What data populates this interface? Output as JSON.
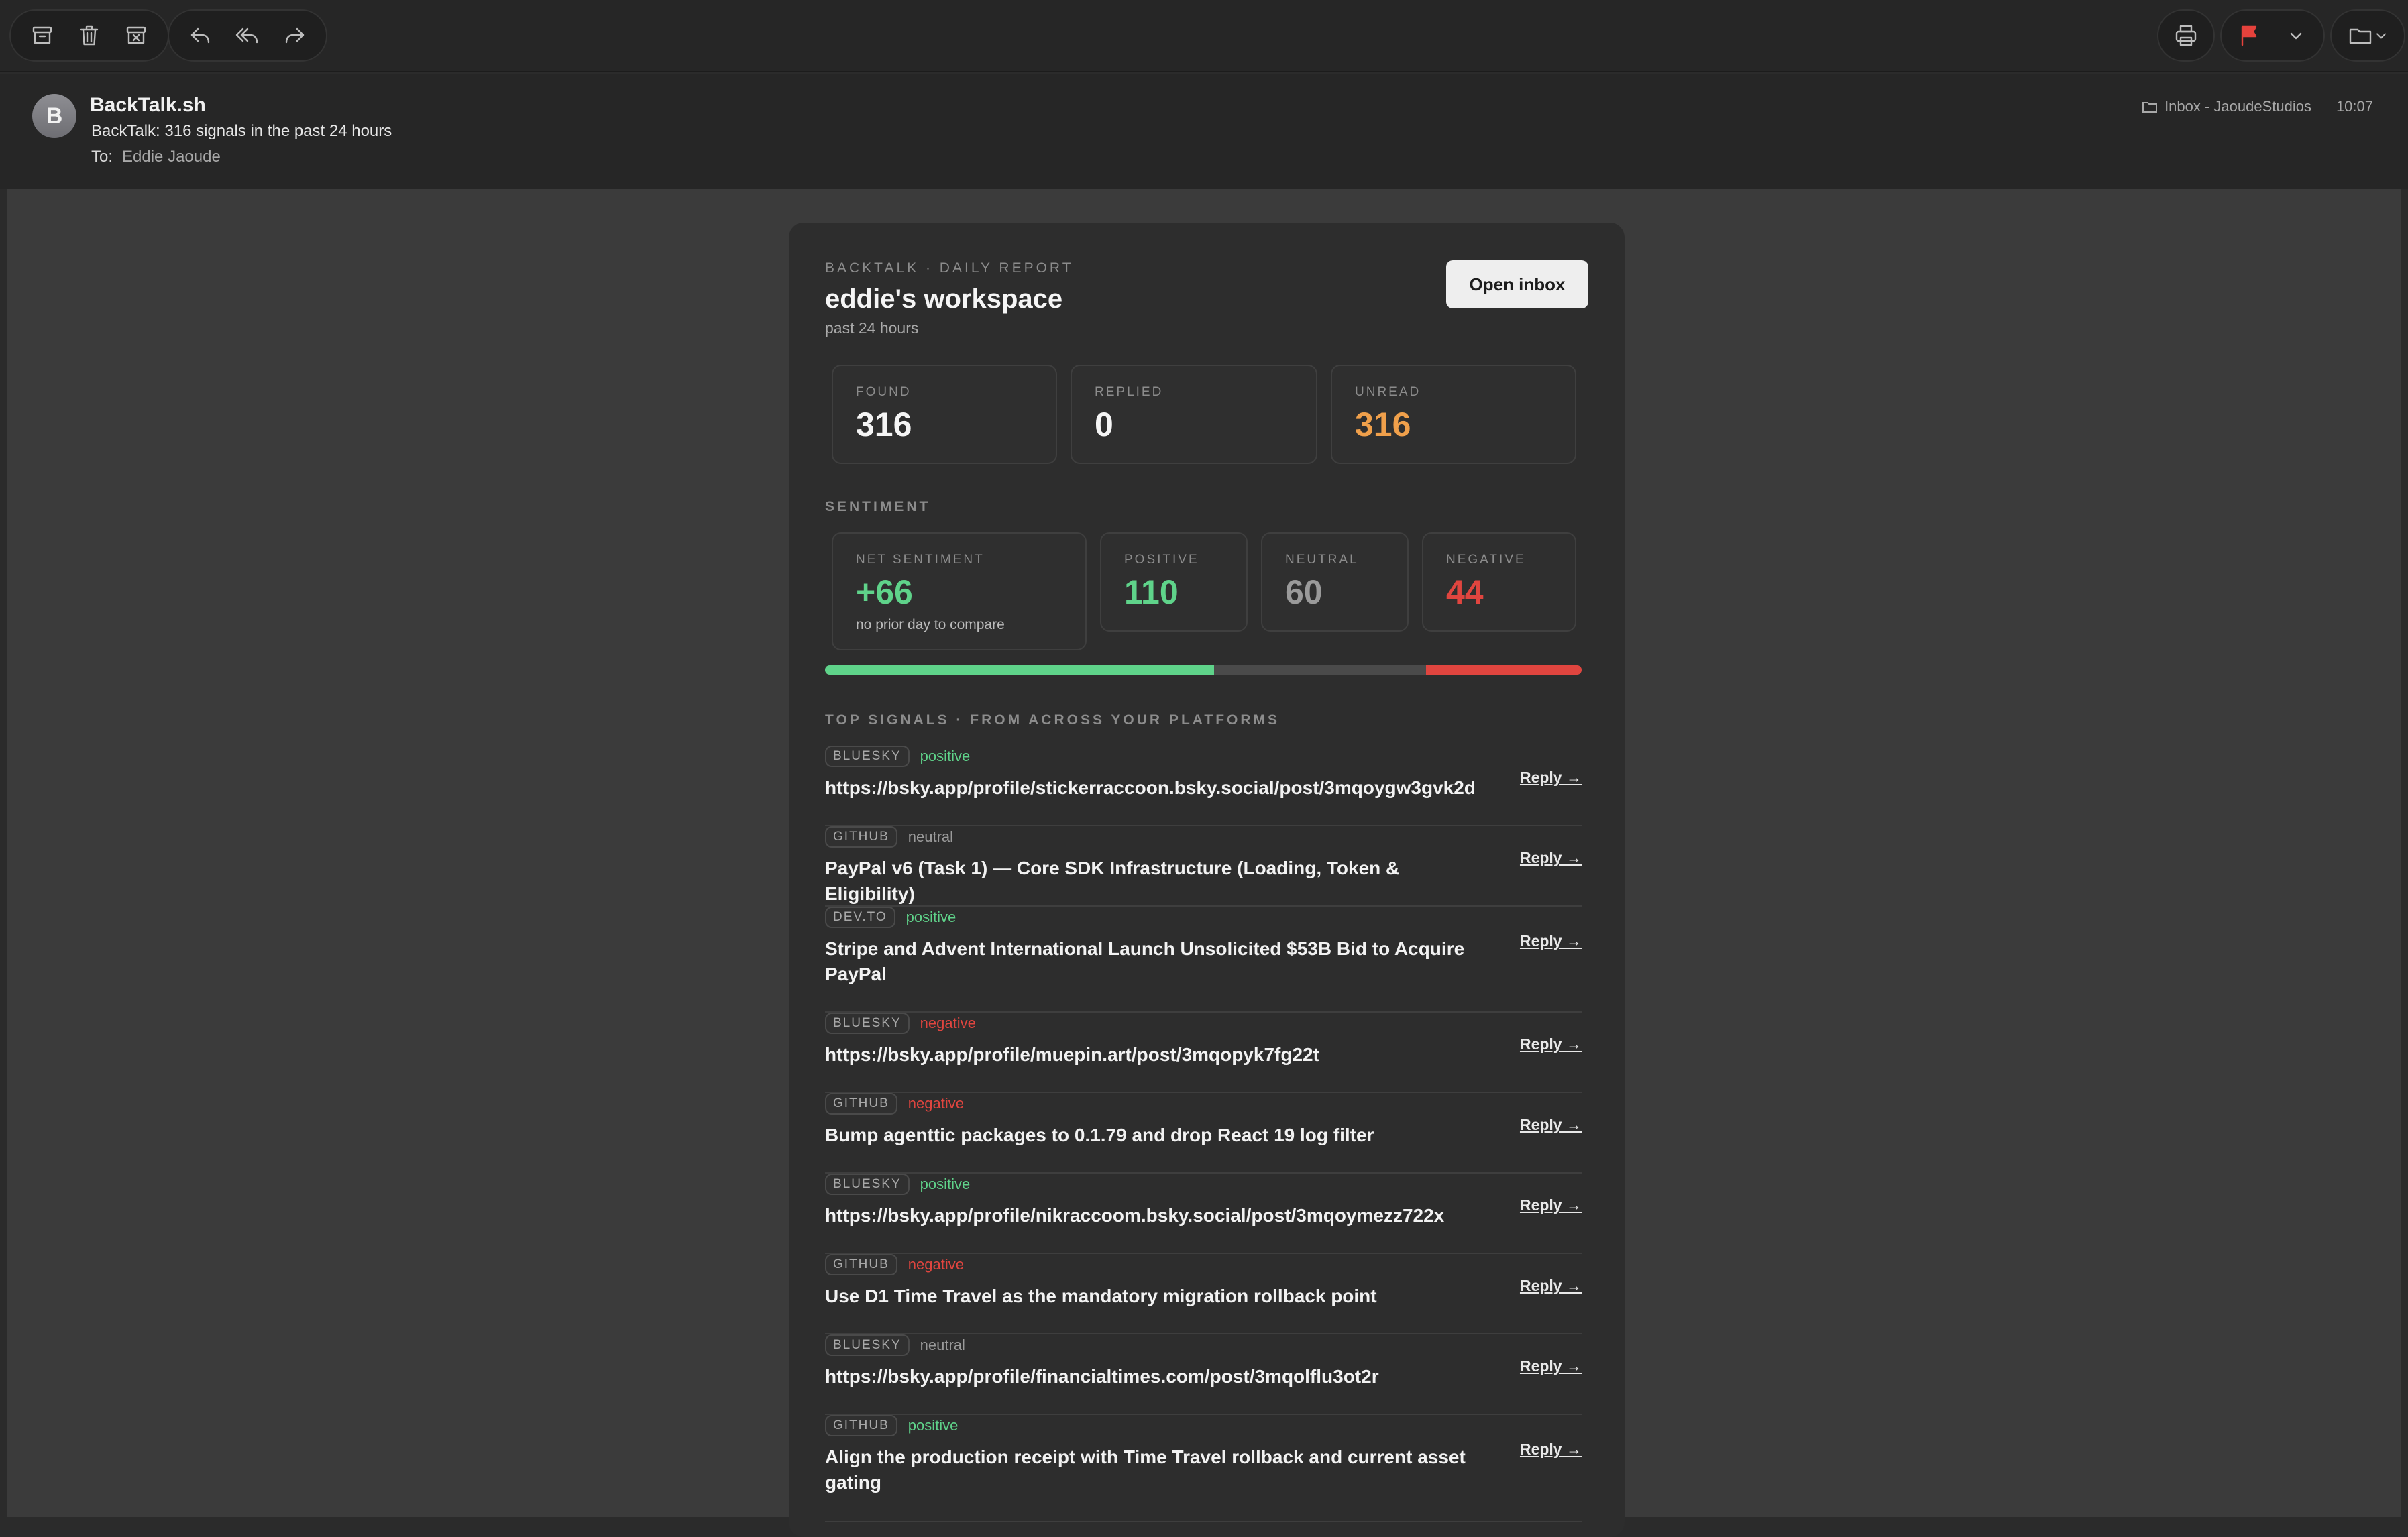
{
  "mail": {
    "sender": "BackTalk.sh",
    "avatar_letter": "B",
    "subject": "BackTalk: 316 signals in the past 24 hours",
    "to_label": "To:",
    "to_name": "Eddie Jaoude",
    "mailbox": "Inbox - JaoudeStudios",
    "time": "10:07"
  },
  "toolbar": {
    "icons": [
      "archive-icon",
      "trash-icon",
      "junk-icon",
      "reply-icon",
      "reply-all-icon",
      "forward-icon",
      "print-icon",
      "flag-icon",
      "chevron-down-icon",
      "folder-icon"
    ],
    "flag_color": "#e5423c"
  },
  "report": {
    "kicker": "BACKTALK · DAILY REPORT",
    "workspace": "eddie's workspace",
    "period": "past 24 hours",
    "open_inbox_label": "Open inbox",
    "stats": {
      "found_label": "FOUND",
      "found_value": "316",
      "replied_label": "REPLIED",
      "replied_value": "0",
      "unread_label": "UNREAD",
      "unread_value": "316"
    },
    "sentiment": {
      "heading": "SENTIMENT",
      "net_label": "NET SENTIMENT",
      "net_value": "+66",
      "net_sub": "no prior day to compare",
      "positive_label": "POSITIVE",
      "positive_value": "110",
      "neutral_label": "NEUTRAL",
      "neutral_value": "60",
      "negative_label": "NEGATIVE",
      "negative_value": "44",
      "bar": {
        "positive": 110,
        "neutral": 60,
        "negative": 44
      }
    },
    "colors": {
      "positive": "#5fd38a",
      "neutral": "#9a9a9a",
      "negative": "#e0453f",
      "unread": "#f0a04b"
    },
    "signals_heading": "TOP SIGNALS · FROM ACROSS YOUR PLATFORMS",
    "reply_label": "Reply →",
    "signals": [
      {
        "platform": "BLUESKY",
        "sentiment": "positive",
        "title": "https://bsky.app/profile/stickerraccoon.bsky.social/post/3mqoygw3gvk2d"
      },
      {
        "platform": "GITHUB",
        "sentiment": "neutral",
        "title": "PayPal v6 (Task 1) — Core SDK Infrastructure (Loading, Token & Eligibility)"
      },
      {
        "platform": "DEV.TO",
        "sentiment": "positive",
        "title": "Stripe and Advent International Launch Unsolicited $53B Bid to Acquire PayPal"
      },
      {
        "platform": "BLUESKY",
        "sentiment": "negative",
        "title": "https://bsky.app/profile/muepin.art/post/3mqopyk7fg22t"
      },
      {
        "platform": "GITHUB",
        "sentiment": "negative",
        "title": "Bump agenttic packages to 0.1.79 and drop React 19 log filter"
      },
      {
        "platform": "BLUESKY",
        "sentiment": "positive",
        "title": "https://bsky.app/profile/nikraccoom.bsky.social/post/3mqoymezz722x"
      },
      {
        "platform": "GITHUB",
        "sentiment": "negative",
        "title": "Use D1 Time Travel as the mandatory migration rollback point"
      },
      {
        "platform": "BLUESKY",
        "sentiment": "neutral",
        "title": "https://bsky.app/profile/financialtimes.com/post/3mqolflu3ot2r"
      },
      {
        "platform": "GITHUB",
        "sentiment": "positive",
        "title": "Align the production receipt with Time Travel rollback and current asset gating"
      }
    ]
  }
}
